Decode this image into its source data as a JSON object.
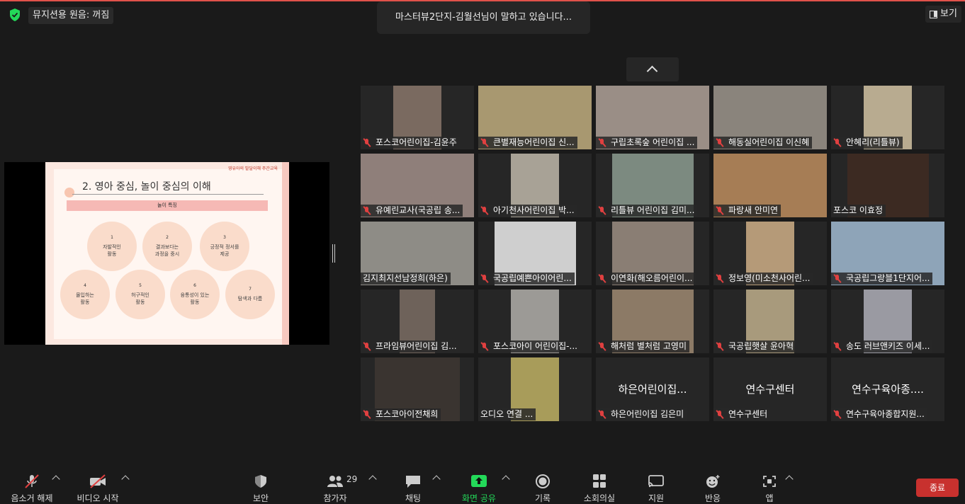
{
  "top": {
    "audio_status": "뮤지션용 원음: 꺼짐",
    "speaking": "마스터뷰2단지-김월선님이 말하고 있습니다...",
    "view_label": "보기"
  },
  "slide": {
    "header": "영유아의 발달이해 주간교육",
    "title": "2. 영아 중심, 놀이 중심의 이해",
    "bar": "놀이 특징",
    "items": [
      {
        "n": "1",
        "t": "자발적인\n활동"
      },
      {
        "n": "2",
        "t": "결과보다는\n과정을 중시"
      },
      {
        "n": "3",
        "t": "긍정적 정서를\n제공"
      },
      {
        "n": "4",
        "t": "몰입하는\n활동"
      },
      {
        "n": "5",
        "t": "허구적인\n활동"
      },
      {
        "n": "6",
        "t": "융통성이 있는\n활동"
      },
      {
        "n": "7",
        "t": "탐색과 다름"
      }
    ]
  },
  "tiles": [
    {
      "name": "포스코어린이집-김윤주",
      "muted": true
    },
    {
      "name": "큰별재능어린이집 신...",
      "muted": true
    },
    {
      "name": "구립초록숲 어린이집 ...",
      "muted": true
    },
    {
      "name": "해동실어린이집 이신혜",
      "muted": true
    },
    {
      "name": "안혜리(리틀뷰)",
      "muted": true
    },
    {
      "name": "유예린교사(국공립 송...",
      "muted": true
    },
    {
      "name": "아기천사어린이집 박...",
      "muted": true
    },
    {
      "name": "리틀뷰 어린이집 김미...",
      "muted": true
    },
    {
      "name": "파랑새 안미연",
      "muted": true
    },
    {
      "name": "포스코 이효정",
      "muted": false
    },
    {
      "name": "김지최지선남정희(하은)",
      "muted": false
    },
    {
      "name": "국공립예쁜아이어린...",
      "muted": true
    },
    {
      "name": "이연화(해오름어린이...",
      "muted": true
    },
    {
      "name": "정보영(미소천사어린...",
      "muted": true
    },
    {
      "name": "국공립그랑블1단지어...",
      "muted": true
    },
    {
      "name": "프라임뷰어린이집 김...",
      "muted": true
    },
    {
      "name": "포스코아이 어린이집-...",
      "muted": true
    },
    {
      "name": "해처럼 별처럼 고영미",
      "muted": true
    },
    {
      "name": "국공립햇살 윤아혁",
      "muted": true
    },
    {
      "name": "송도 러브앤키즈 이세...",
      "muted": true
    },
    {
      "name": "포스코아이전채희",
      "muted": true
    },
    {
      "name": "오디오 연결 ...",
      "muted": false
    },
    {
      "name": "하은어린이집 김은미",
      "muted": true,
      "big": "하은어린이집..."
    },
    {
      "name": "연수구센터",
      "muted": true,
      "big": "연수구센터"
    },
    {
      "name": "연수구육아종합지원...",
      "muted": true,
      "big": "연수구육아종...."
    }
  ],
  "toolbar": {
    "mute": "음소거 해제",
    "video": "비디오 시작",
    "security": "보안",
    "participants": "참가자",
    "participant_count": "29",
    "chat": "채팅",
    "share": "화면 공유",
    "record": "기록",
    "breakout": "소회의실",
    "support": "지원",
    "reactions": "반응",
    "apps": "앱",
    "end": "종료"
  },
  "colors": {
    "accent_green": "#23d959",
    "end_red": "#c8312e",
    "muted_red": "#e04040"
  }
}
